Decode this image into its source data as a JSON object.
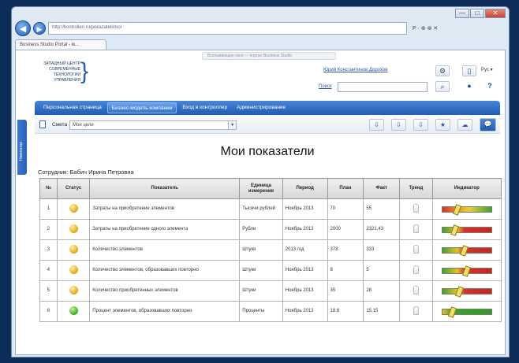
{
  "browser": {
    "address": "http://kontrolleri.ru/pokazateli/moi",
    "tab_title": "Business Studio Portal - м...",
    "tools": "P · ⊕ ⊗ ✕",
    "hint_tab": "Всплывающее окно — портал Business Studio",
    "controls": [
      "—",
      "□",
      "✕"
    ]
  },
  "header": {
    "logo_lines": [
      "ЗАПАДНЫЙ ЦЕНТР",
      "СОВРЕМЕННЫЕ",
      "ТЕХНОЛОГИИ",
      "УПРАВЛЕНИЯ"
    ],
    "user_link": "Юрий Константинов Дорохов",
    "lang": "Рус ▾",
    "search_label": "Поиск"
  },
  "menu": {
    "items": [
      "Персональная страница",
      "Бизнес-модель компании",
      "Вход в контроллер",
      "Администрирование"
    ],
    "active_index": 1
  },
  "side_tab": "Навигатор",
  "toolbar": {
    "label": "Смета",
    "select_value": "Мои цели",
    "buttons": [
      "⇩",
      "⇩",
      "⇩",
      "★",
      "☁",
      "💬"
    ]
  },
  "page": {
    "title": "Мои показатели",
    "employee": "Сотрудник: Бабич Ирина Петровна"
  },
  "table": {
    "headers": [
      "№",
      "Статус",
      "Показатель",
      "Единица измерения",
      "Период",
      "План",
      "Факт",
      "Тренд",
      "Индикатор"
    ],
    "rows": [
      {
        "n": "1",
        "status": "yellow",
        "name": "Затраты на приобретение элементов",
        "unit": "Тысячи рублей",
        "period": "Ноябрь 2013",
        "plan": "70",
        "fact": "55",
        "indicator": 0.25
      },
      {
        "n": "2",
        "status": "yellow",
        "name": "Затраты на приобретение одного элемента",
        "unit": "Рубли",
        "period": "Ноябрь 2013",
        "plan": "2000",
        "fact": "2321,43",
        "indicator": 0.2
      },
      {
        "n": "3",
        "status": "yellow",
        "name": "Количество элементов",
        "unit": "Штуки",
        "period": "2013 год",
        "plan": "378",
        "fact": "333",
        "indicator": 0.4
      },
      {
        "n": "4",
        "status": "yellow",
        "name": "Количество элементов, образовавших повторно",
        "unit": "Штуки",
        "period": "Ноябрь 2013",
        "plan": "8",
        "fact": "5",
        "indicator": 0.45
      },
      {
        "n": "5",
        "status": "yellow",
        "name": "Количество приобретенных элементов",
        "unit": "Штуки",
        "period": "Ноябрь 2013",
        "plan": "35",
        "fact": "28",
        "indicator": 0.3
      },
      {
        "n": "6",
        "status": "green",
        "name": "Процент элементов, образовавших повторно",
        "unit": "Проценты",
        "period": "Ноябрь 2013",
        "plan": "18,6",
        "fact": "15,15",
        "indicator": 0.15
      }
    ]
  },
  "colors": {
    "menu": "#2563b8",
    "status_yellow": "#e3a61a",
    "status_green": "#3fae20"
  }
}
